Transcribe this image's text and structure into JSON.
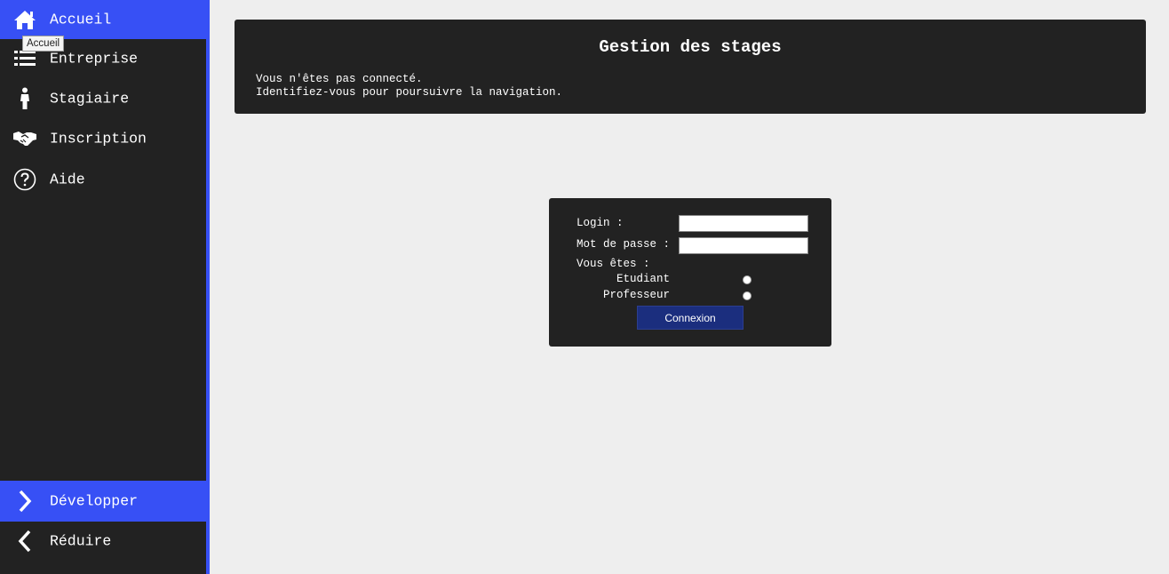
{
  "sidebar": {
    "items": [
      {
        "label": "Accueil",
        "icon": "home-icon"
      },
      {
        "label": "Entreprise",
        "icon": "list-icon"
      },
      {
        "label": "Stagiaire",
        "icon": "person-icon"
      },
      {
        "label": "Inscription",
        "icon": "handshake-icon"
      },
      {
        "label": "Aide",
        "icon": "help-icon"
      }
    ],
    "tooltip": "Accueil",
    "bottom": [
      {
        "label": "Développer",
        "icon": "chevron-right-icon"
      },
      {
        "label": "Réduire",
        "icon": "chevron-left-icon"
      }
    ],
    "accent_color": "#3750f5",
    "background_color": "#222222"
  },
  "header": {
    "title": "Gestion des stages",
    "line1": "Vous n'êtes pas connecté.",
    "line2": "Identifiez-vous pour poursuivre la navigation."
  },
  "login": {
    "login_label": "Login :",
    "password_label": "Mot de passe :",
    "role_label": "Vous êtes :",
    "role_student": "Etudiant",
    "role_teacher": "Professeur",
    "submit": "Connexion",
    "button_color": "#1b2e7e"
  }
}
